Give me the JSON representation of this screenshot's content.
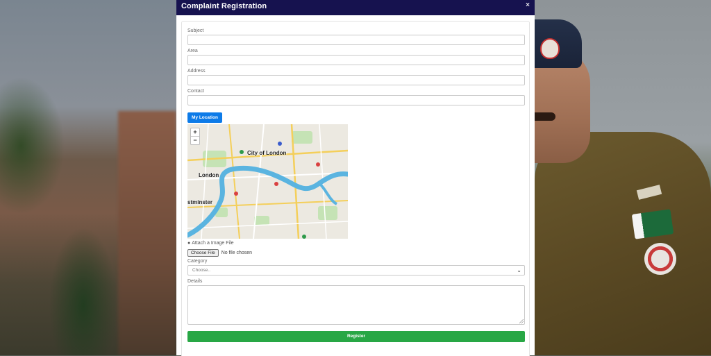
{
  "modal": {
    "title": "Complaint Registration",
    "close_glyph": "×"
  },
  "form": {
    "subject": {
      "label": "Subject",
      "value": ""
    },
    "area": {
      "label": "Area",
      "value": ""
    },
    "address": {
      "label": "Address",
      "value": ""
    },
    "contact": {
      "label": "Contact",
      "value": ""
    },
    "my_location_label": "My Location",
    "map": {
      "zoom_in": "+",
      "zoom_out": "−",
      "labels": {
        "city_of_london": "City of London",
        "london": "London",
        "westminster": "stminster"
      }
    },
    "attach_label": "Attach a Image File",
    "attach_icon": "camera-icon",
    "file_button": "Choose File",
    "file_status": "No file chosen",
    "category": {
      "label": "Category",
      "selected": "Choose.."
    },
    "details": {
      "label": "Details",
      "value": ""
    },
    "register_label": "Register"
  },
  "colors": {
    "header": "#16124f",
    "location_button": "#0d7be8",
    "register_button": "#28a745",
    "river": "#5ab4e0"
  }
}
